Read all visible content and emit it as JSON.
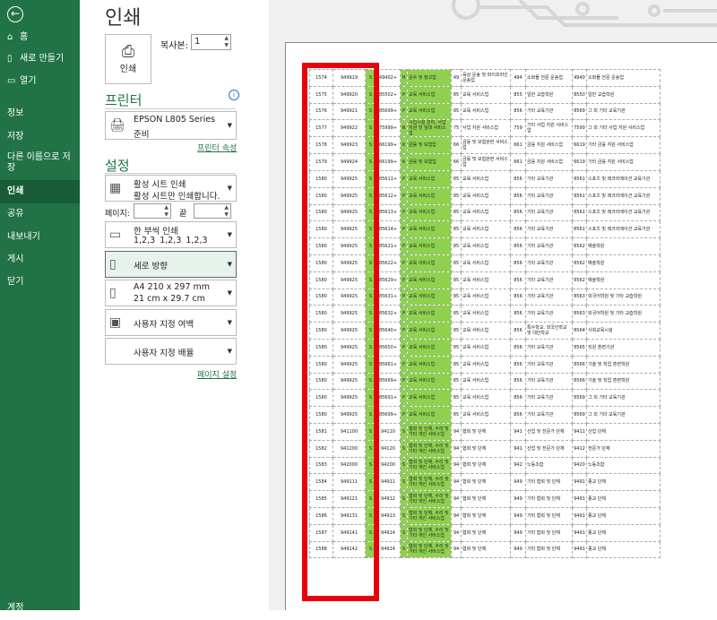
{
  "sidebar": {
    "items": [
      {
        "label": "홈",
        "icon": "home-icon"
      },
      {
        "label": "새로 만들기",
        "icon": "new-doc-icon"
      },
      {
        "label": "열기",
        "icon": "folder-icon"
      },
      {
        "label": "정보"
      },
      {
        "label": "저장"
      },
      {
        "label": "다른 이름으로 저장"
      },
      {
        "label": "인쇄",
        "active": true
      },
      {
        "label": "공유"
      },
      {
        "label": "내보내기"
      },
      {
        "label": "게시"
      },
      {
        "label": "닫기"
      }
    ],
    "account_label": "계정"
  },
  "print": {
    "title": "인쇄",
    "print_button_label": "인쇄",
    "copies_label": "복사본:",
    "copies_value": "1",
    "printer_section": "프린터",
    "printer_name": "EPSON L805 Series",
    "printer_status": "준비",
    "printer_properties_link": "프린터 속성",
    "settings_section": "설정",
    "active_sheets_title": "활성 시트 인쇄",
    "active_sheets_desc": "활성 시트만 인쇄합니다.",
    "pages_label": "페이지:",
    "to_label": "끝",
    "collate_title": "한 부씩 인쇄",
    "collate_desc": "1,2,3    1,2,3    1,2,3",
    "orientation": "세로 방향",
    "paper_size": "A4 210 x 297 mm",
    "paper_size_desc": "21 cm x 29.7 cm",
    "margins": "사용자 지정 여백",
    "scaling": "사용자 지정 배율",
    "page_setup_link": "페이지 설정"
  },
  "sheet_rows": [
    [
      "1574",
      "949919",
      "S",
      "49402+",
      "H",
      "운수 및 창고업",
      "49",
      "육상 운송 및 파이프라인 운송업",
      "494",
      "소화물 전문 운송업",
      "4940",
      "소화물 전문 운송업"
    ],
    [
      "1575",
      "949920",
      "S",
      "85502+",
      "P",
      "교육 서비스업",
      "85",
      "교육 서비스업",
      "855",
      "일반 교습학원",
      "8550",
      "일반 교습학원"
    ],
    [
      "1576",
      "949921",
      "S",
      "85699+",
      "P",
      "교육 서비스업",
      "85",
      "교육 서비스업",
      "856",
      "기타 교육기관",
      "8569",
      "그 외 기타 교육기관"
    ],
    [
      "1577",
      "949922",
      "S",
      "75999+",
      "N",
      "사업시설 관리, 사업 지원 및 임대 서비스업",
      "75",
      "사업 지원 서비스업",
      "759",
      "기타 사업 지원 서비스업",
      "7599",
      "그 외 기타 사업 지원 서비스업"
    ],
    [
      "1578",
      "949923",
      "S",
      "66199+",
      "K",
      "금융 및 보험업",
      "66",
      "금융 및 보험관련 서비스업",
      "661",
      "금융 지원 서비스업",
      "6619",
      "기타 금융 지원 서비스업"
    ],
    [
      "1579",
      "949924",
      "S",
      "66199+",
      "K",
      "금융 및 보험업",
      "66",
      "금융 및 보험관련 서비스업",
      "661",
      "금융 지원 서비스업",
      "6619",
      "기타 금융 지원 서비스업"
    ],
    [
      "1580",
      "949925",
      "S",
      "85611+",
      "P",
      "교육 서비스업",
      "85",
      "교육 서비스업",
      "856",
      "기타 교육기관",
      "8561",
      "스포츠 및 레크리에이션 교육기관"
    ],
    [
      "1580",
      "949925",
      "S",
      "85612+",
      "P",
      "교육 서비스업",
      "85",
      "교육 서비스업",
      "856",
      "기타 교육기관",
      "8561",
      "스포츠 및 레크리에이션 교육기관"
    ],
    [
      "1580",
      "949925",
      "S",
      "85613+",
      "P",
      "교육 서비스업",
      "85",
      "교육 서비스업",
      "856",
      "기타 교육기관",
      "8561",
      "스포츠 및 레크리에이션 교육기관"
    ],
    [
      "1580",
      "949925",
      "S",
      "85614+",
      "P",
      "교육 서비스업",
      "85",
      "교육 서비스업",
      "856",
      "기타 교육기관",
      "8561",
      "스포츠 및 레크리에이션 교육기관"
    ],
    [
      "1580",
      "949925",
      "S",
      "85621+",
      "P",
      "교육 서비스업",
      "85",
      "교육 서비스업",
      "856",
      "기타 교육기관",
      "8562",
      "예술학원"
    ],
    [
      "1580",
      "949925",
      "S",
      "85622+",
      "P",
      "교육 서비스업",
      "85",
      "교육 서비스업",
      "856",
      "기타 교육기관",
      "8562",
      "예술학원"
    ],
    [
      "1580",
      "949925",
      "S",
      "85629+",
      "P",
      "교육 서비스업",
      "85",
      "교육 서비스업",
      "856",
      "기타 교육기관",
      "8562",
      "예술학원"
    ],
    [
      "1580",
      "949925",
      "S",
      "85631+",
      "P",
      "교육 서비스업",
      "85",
      "교육 서비스업",
      "856",
      "기타 교육기관",
      "8563",
      "외국어학원 및 기타 교습학원"
    ],
    [
      "1580",
      "949925",
      "S",
      "85632+",
      "P",
      "교육 서비스업",
      "85",
      "교육 서비스업",
      "856",
      "기타 교육기관",
      "8563",
      "외국어학원 및 기타 교습학원"
    ],
    [
      "1580",
      "949925",
      "S",
      "85640+",
      "P",
      "교육 서비스업",
      "85",
      "교육 서비스업",
      "856",
      "특수학교, 외국인학교 및 대안학교",
      "8564",
      "사회교육시설"
    ],
    [
      "1580",
      "949925",
      "S",
      "85650+",
      "P",
      "교육 서비스업",
      "85",
      "교육 서비스업",
      "856",
      "기타 교육기관",
      "8565",
      "직원 훈련기관"
    ],
    [
      "1580",
      "949925",
      "S",
      "85661+",
      "P",
      "교육 서비스업",
      "85",
      "교육 서비스업",
      "856",
      "기타 교육기관",
      "8566",
      "기술 및 직업 훈련학원"
    ],
    [
      "1580",
      "949925",
      "S",
      "85669+",
      "P",
      "교육 서비스업",
      "85",
      "교육 서비스업",
      "856",
      "기타 교육기관",
      "8566",
      "기술 및 직업 훈련학원"
    ],
    [
      "1580",
      "949925",
      "S",
      "85691+",
      "P",
      "교육 서비스업",
      "85",
      "교육 서비스업",
      "856",
      "기타 교육기관",
      "8569",
      "그 외 기타 교육기관"
    ],
    [
      "1580",
      "949925",
      "S",
      "85699+",
      "P",
      "교육 서비스업",
      "85",
      "교육 서비스업",
      "856",
      "기타 교육기관",
      "8569",
      "그 외 기타 교육기관"
    ],
    [
      "1581",
      "941100",
      "S",
      "94110",
      "S",
      "협회 및 단체, 수리 및 기타 개인 서비스업",
      "94",
      "협회 및 단체",
      "941",
      "산업 및 전문가 단체",
      "9411",
      "산업 단체"
    ],
    [
      "1582",
      "941200",
      "S",
      "94120",
      "S",
      "협회 및 단체, 수리 및 기타 개인 서비스업",
      "94",
      "협회 및 단체",
      "941",
      "산업 및 전문가 단체",
      "9412",
      "전문가 단체"
    ],
    [
      "1583",
      "942000",
      "S",
      "94200",
      "S",
      "협회 및 단체, 수리 및 기타 개인 서비스업",
      "94",
      "협회 및 단체",
      "942",
      "노동조합",
      "9420",
      "노동조합"
    ],
    [
      "1584",
      "949111",
      "S",
      "94911",
      "S",
      "협회 및 단체, 수리 및 기타 개인 서비스업",
      "94",
      "협회 및 단체",
      "949",
      "기타 협회 및 단체",
      "9491",
      "종교 단체"
    ],
    [
      "1585",
      "949121",
      "S",
      "94912",
      "S",
      "협회 및 단체, 수리 및 기타 개인 서비스업",
      "94",
      "협회 및 단체",
      "949",
      "기타 협회 및 단체",
      "9491",
      "종교 단체"
    ],
    [
      "1586",
      "949131",
      "S",
      "94913",
      "S",
      "협회 및 단체, 수리 및 기타 개인 서비스업",
      "94",
      "협회 및 단체",
      "949",
      "기타 협회 및 단체",
      "9491",
      "종교 단체"
    ],
    [
      "1587",
      "949141",
      "S",
      "94914",
      "S",
      "협회 및 단체, 수리 및 기타 개인 서비스업",
      "94",
      "협회 및 단체",
      "949",
      "기타 협회 및 단체",
      "9491",
      "종교 단체"
    ],
    [
      "1588",
      "949142",
      "S",
      "94914",
      "S",
      "협회 및 단체, 수리 및 기타 개인 서비스업",
      "94",
      "협회 및 단체",
      "949",
      "기타 협회 및 단체",
      "9491",
      "종교 단체"
    ]
  ],
  "colors": {
    "sidebar": "#217346",
    "highlight": "#8fd14f",
    "red_box": "#e8000b"
  }
}
